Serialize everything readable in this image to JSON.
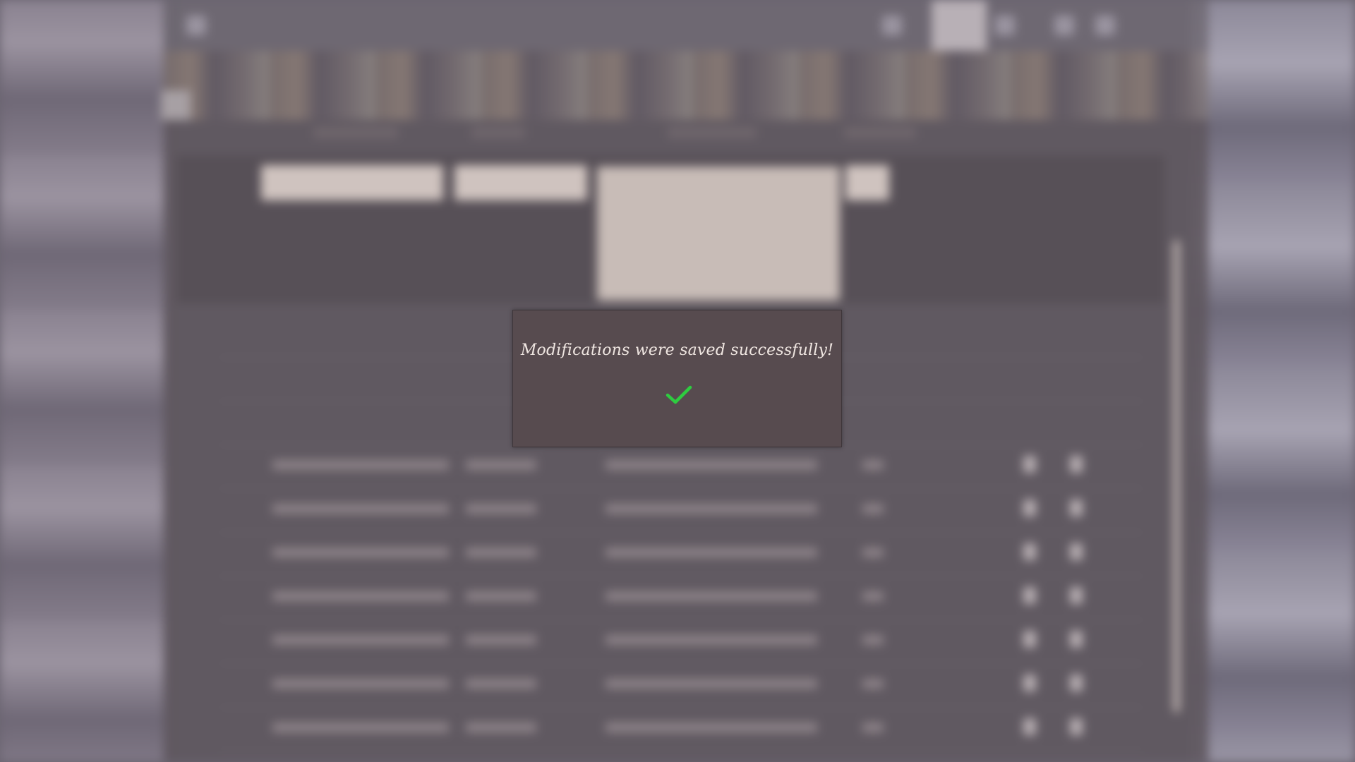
{
  "modal": {
    "message": "Modifications were saved successfully!",
    "icon": "check-icon",
    "icon_color": "#2ecc40"
  },
  "colors": {
    "modal_bg": "#574b4f",
    "modal_text": "#efe6e1",
    "overlay": "#6a6470"
  }
}
